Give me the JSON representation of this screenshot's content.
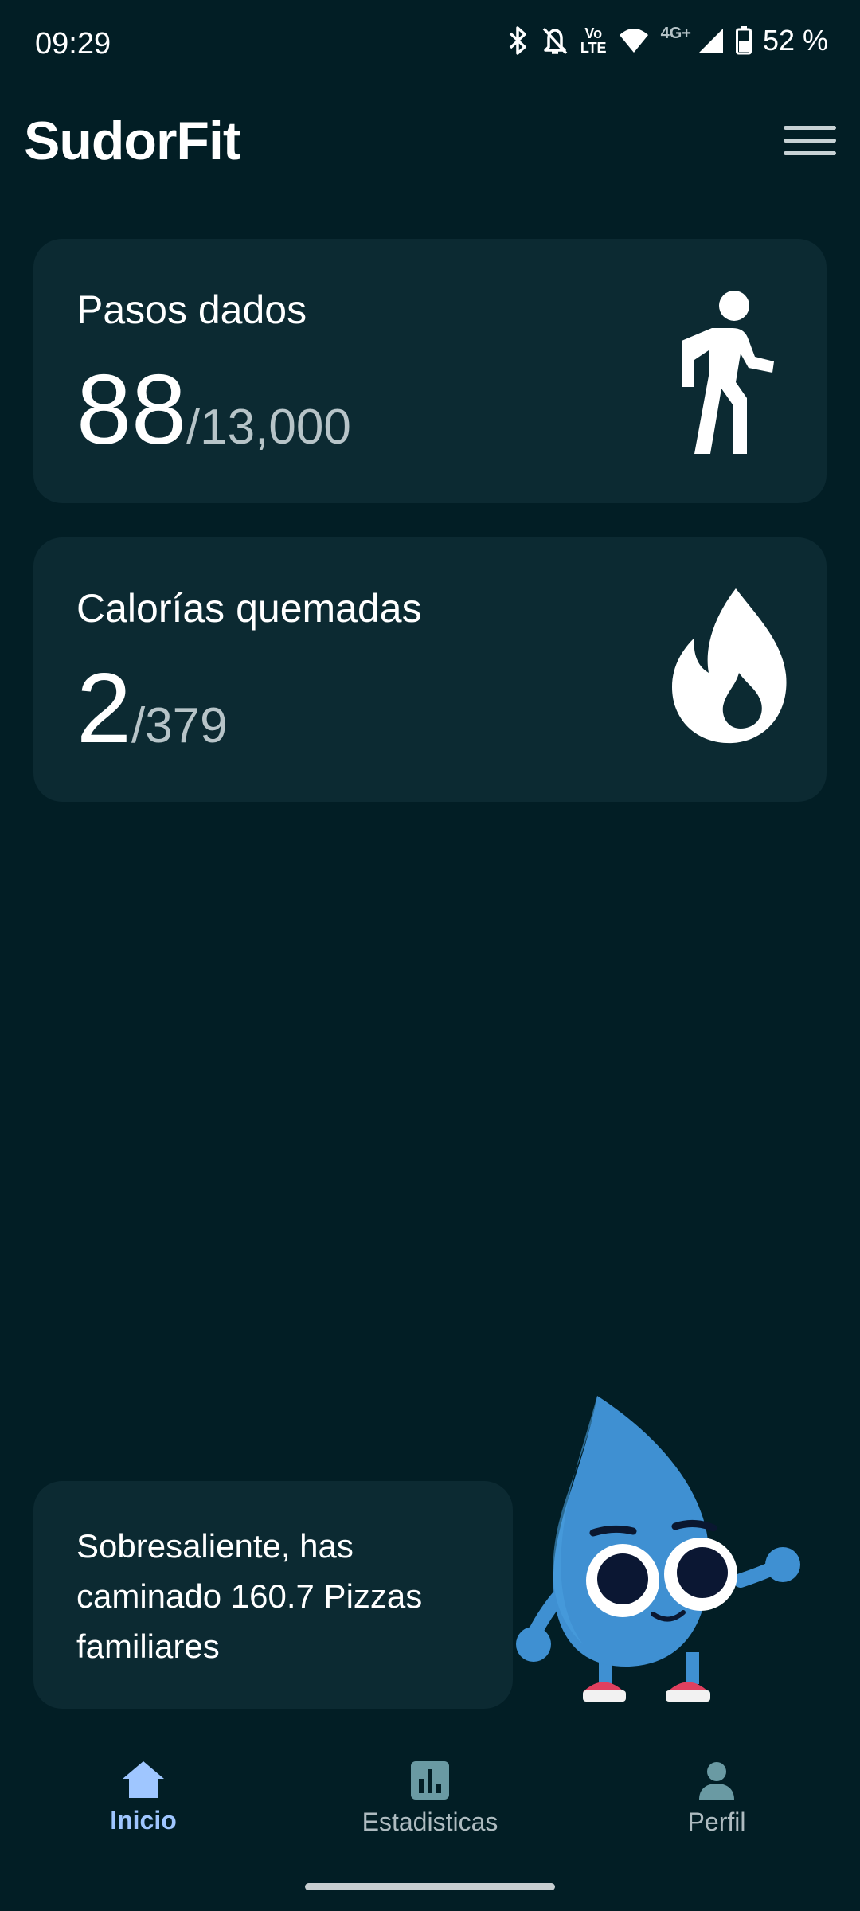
{
  "status_bar": {
    "time": "09:29",
    "network_tag": "4G+",
    "volte_tag_top": "Vo",
    "volte_tag_bottom": "LTE",
    "battery": "52 %"
  },
  "app": {
    "title": "SudorFit"
  },
  "cards": {
    "steps": {
      "label": "Pasos dados",
      "value": "88",
      "goal": "/13,000",
      "icon": "walking-person-icon"
    },
    "calories": {
      "label": "Calorías quemadas",
      "value": "2",
      "goal": "/379",
      "icon": "flame-icon"
    }
  },
  "message": {
    "text": "Sobresaliente, has caminado 160.7 Pizzas familiares"
  },
  "mascot": {
    "icon": "water-drop-mascot"
  },
  "nav": {
    "items": [
      {
        "label": "Inicio",
        "icon": "home-icon",
        "active": true
      },
      {
        "label": "Estadisticas",
        "icon": "bar-chart-icon",
        "active": false
      },
      {
        "label": "Perfil",
        "icon": "person-icon",
        "active": false
      }
    ]
  },
  "colors": {
    "background": "#021e25",
    "card": "#0c2a32",
    "accent": "#9fc6ff",
    "mascot": "#3f90d2"
  }
}
